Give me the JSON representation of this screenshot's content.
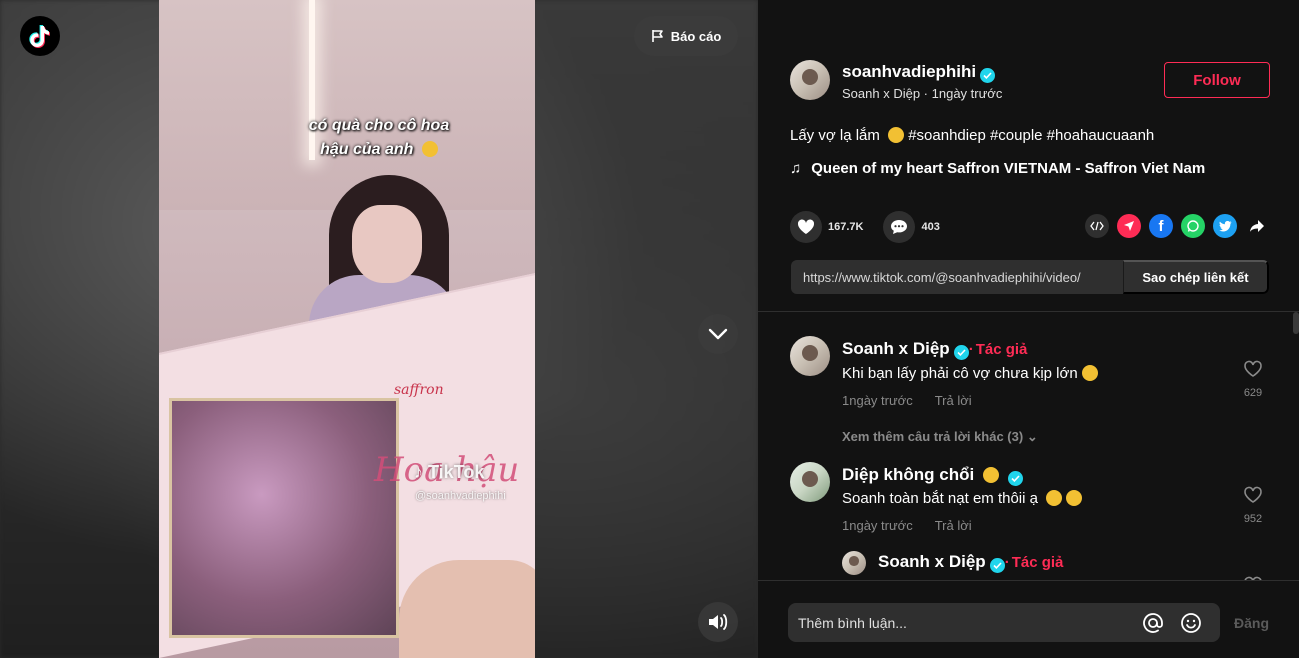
{
  "report": {
    "label": "Báo cáo"
  },
  "video": {
    "caption_line1": "có quà cho cô hoa",
    "caption_line2": "hậu của anh",
    "watermark": "TikTok",
    "watermark_user": "@soanhvadiephihi",
    "box_logo": "saffron",
    "box_script": "Hoa hậu"
  },
  "author": {
    "username": "soanhvadiephihi",
    "nickname": "Soanh x Diệp",
    "time": "1ngày trước",
    "follow_label": "Follow"
  },
  "description": {
    "text": "Lấy vợ lạ lắm",
    "hashtags": "#soanhdiep #couple #hoahaucuaanh"
  },
  "music": {
    "title": "Queen of my heart Saffron VIETNAM - Saffron Viet Nam"
  },
  "stats": {
    "likes": "167.7K",
    "comments": "403"
  },
  "link": {
    "url": "https://www.tiktok.com/@soanhvadiephihi/video/",
    "copy_label": "Sao chép liên kết"
  },
  "comments": [
    {
      "name": "Soanh x Diệp",
      "author_tag": "Tác giả",
      "text": "Khi bạn lấy phải cô vợ chưa kịp lớn",
      "time": "1ngày trước",
      "reply": "Trả lời",
      "likes": "629",
      "more_replies": "Xem thêm câu trả lời khác (3)"
    },
    {
      "name": "Diệp không chổi",
      "text": "Soanh toàn bắt nạt em thôii ạ",
      "time": "1ngày trước",
      "reply": "Trả lời",
      "likes": "952"
    },
    {
      "name": "Soanh x Diệp",
      "author_tag": "Tác giả"
    }
  ],
  "footer": {
    "placeholder": "Thêm bình luận...",
    "post_label": "Đăng"
  },
  "colors": {
    "accent": "#fe2c55",
    "verified": "#20d5ec",
    "background": "#121212"
  }
}
